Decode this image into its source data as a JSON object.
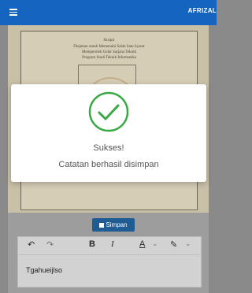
{
  "app": {
    "title": "AFRIZAL",
    "menu_icon": "menu-icon"
  },
  "document": {
    "lines": [
      "Skripsi",
      "Diajukan untuk Memenuhi Salah Satu Syarat",
      "Memperoleh Gelar Sarjana Teknik",
      "Program Studi Teknik Informatika"
    ]
  },
  "dialog": {
    "icon": "check-circle-icon",
    "title": "Sukses!",
    "message": "Catatan berhasil disimpan",
    "accent_color": "#3aa843"
  },
  "save_button": {
    "label": "Simpan",
    "icon": "save-icon",
    "color": "#1f5c93"
  },
  "editor_toolbar": {
    "undo": "↶",
    "redo": "↷",
    "bold": "B",
    "italic": "I",
    "text_color": "A",
    "highlight": "✎",
    "dropdown": "⌄"
  },
  "editor": {
    "content": "Tgahueijlso"
  }
}
